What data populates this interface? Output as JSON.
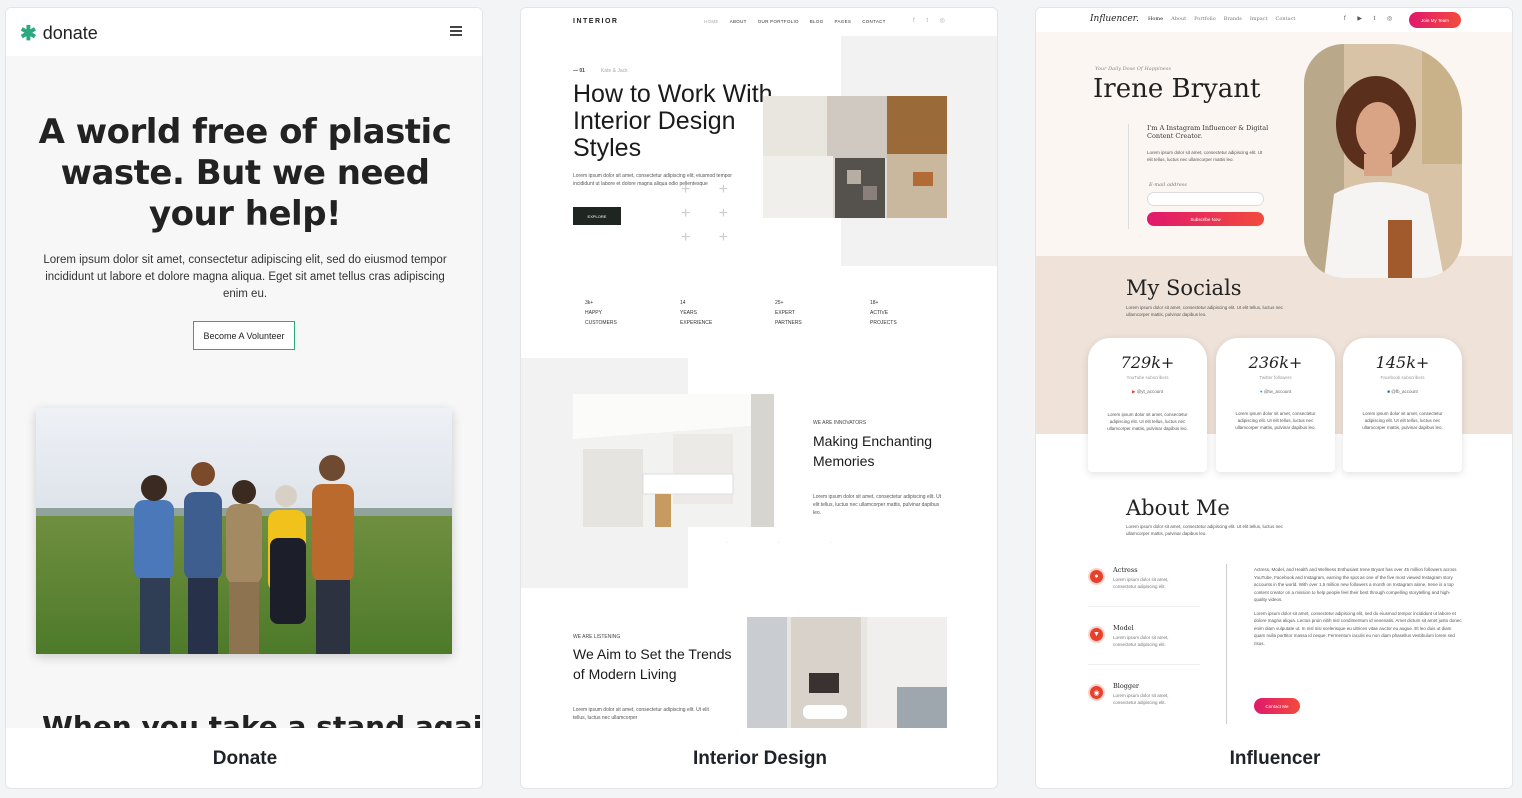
{
  "cards": [
    {
      "label": "Donate",
      "site": {
        "logo": "donate",
        "headline": "A world free of plastic waste. But we need your help!",
        "body": "Lorem ipsum dolor sit amet, consectetur adipiscing elit, sed do eiusmod tempor incididunt ut labore et dolore magna aliqua. Eget sit amet tellus cras adipiscing enim eu.",
        "cta": "Become A Volunteer",
        "cut_heading": "When you take a stand against",
        "accent": "#2aa87e",
        "icons": [
          "asterisk-logo-icon",
          "hamburger-menu-icon"
        ]
      }
    },
    {
      "label": "Interior Design",
      "site": {
        "brand": "INTERIOR",
        "nav": [
          "HOME",
          "ABOUT",
          "OUR PORTFOLIO",
          "BLOG",
          "PAGES",
          "CONTACT"
        ],
        "social": "f  t  ◎",
        "eyebrow_num": "— 01",
        "eyebrow_text": "Kate & Jack",
        "headline": "How to Work With Interior Design Styles",
        "body": "Lorem ipsum dolor sit amet, consectetur adipiscing elit, eiusmod tempor incididunt ut labore et dolore magna aliqua odio pellentesque",
        "cta": "EXPLORE",
        "stats": [
          {
            "value": "3k+",
            "label": "HAPPY CUSTOMERS"
          },
          {
            "value": "14",
            "label": "YEARS EXPERIENCE"
          },
          {
            "value": "25+",
            "label": "EXPERT PARTNERS"
          },
          {
            "value": "18+",
            "label": "ACTIVE PROJECTS"
          }
        ],
        "section2_eyebrow": "WE ARE INNOVATORS",
        "section2_title": "Making Enchanting Memories",
        "section2_body": "Lorem ipsum dolor sit amet, consectetur adipiscing elit. Ut elit tellus, luctus nec ullamcorper mattis, pulvinar dapibus leo.",
        "section3_eyebrow": "WE ARE LISTENING",
        "section3_title": "We Aim to Set the Trends of Modern Living",
        "section3_body": "Lorem ipsum dolor sit amet, consectetur adipiscing elit. Ut elit tellus, luctus nec ullamcorper"
      }
    },
    {
      "label": "Influencer",
      "site": {
        "logo": "Influencer.",
        "nav": [
          "Home",
          "About",
          "Portfolio",
          "Brands",
          "Impact",
          "Contact"
        ],
        "social": "f ▶ t ◎",
        "join_cta": "Join My Team",
        "tagline": "Your Daily Dose Of Happiness",
        "name": "Irene Bryant",
        "bio": "I'm A Instagram Influencer & Digital Content Creator.",
        "bio_body": "Lorem ipsum dolor sit amet, consectetur adipiscing elit. Ut elit tellus, luctus nec ullamcorper mattis leo.",
        "email_label": "E-mail address",
        "subscribe_cta": "Subscribe Now",
        "socials_title": "My Socials",
        "socials_body": "Lorem ipsum dolor sit amet, consectetur adipiscing elit. Ut elit tellus, luctus nec ullamcorper mattis, pulvinar dapibus leo.",
        "social_cards": [
          {
            "count": "729k+",
            "platform": "YouTube subscribers",
            "handle": "@yt_account",
            "text": "Lorem ipsum dolor sit amet, consectetur adipiscing elit. Ut elit tellus, luctus nec ullamcorper mattis, pulvinar dapibus leo."
          },
          {
            "count": "236k+",
            "platform": "Twitter followers",
            "handle": "@tw_account",
            "text": "Lorem ipsum dolor sit amet, consectetur adipiscing elit. Ut elit tellus, luctus nec ullamcorper mattis, pulvinar dapibus leo."
          },
          {
            "count": "145k+",
            "platform": "Facebook subscribers",
            "handle": "@fb_account",
            "text": "Lorem ipsum dolor sit amet, consectetur adipiscing elit. Ut elit tellus, luctus nec ullamcorper mattis, pulvinar dapibus leo."
          }
        ],
        "about_title": "About Me",
        "about_body": "Lorem ipsum dolor sit amet, consectetur adipiscing elit. Ut elit tellus, luctus nec ullamcorper mattis, pulvinar dapibus leo.",
        "roles": [
          {
            "title": "Actress",
            "desc": "Lorem ipsum dolor sit amet, consectetur adipiscing elit."
          },
          {
            "title": "Model",
            "desc": "Lorem ipsum dolor sit amet, consectetur adipiscing elit."
          },
          {
            "title": "Blogger",
            "desc": "Lorem ipsum dolor sit amet, consectetur adipiscing elit."
          }
        ],
        "about_right_1": "Actress, Model, and Health and Wellness Enthusiast Irene Bryant has over 45 million followers across YouTube, Facebook and Instagram, earning the spot as one of the five most viewed Instagram story accounts in the world. With over 1.5 million new followers a month on Instagram alone, Irene is a top content creator on a mission to help people feel their best through compelling storytelling and high-quality videos.",
        "about_right_2": "Lorem ipsum dolor sit amet, consectetur adipiscing elit, sed do eiusmod tempor incididunt ut labore et dolore magna aliqua. Lectus proin nibh nisl condimentum id venenatis. Amet dictum sit amet justo donec enim diam vulputate ut. In nisl nisi scelerisque eu ultrices vitae auctor eu augue. Et leo duis ut diam quam nulla porttitor massa id neque. Fermentum iaculis eu non diam phasellus vestibulum lorem sed risus.",
        "contact_cta": "Contact Me",
        "accent": "#e0186d"
      }
    }
  ]
}
